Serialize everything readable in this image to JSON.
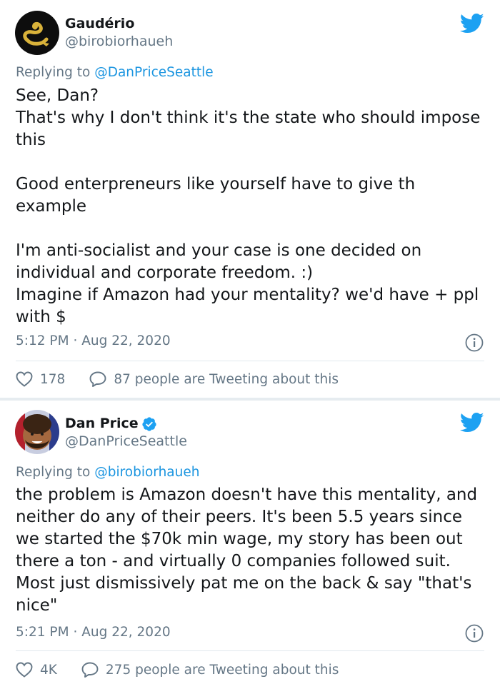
{
  "tweets": [
    {
      "name": "Gaudério",
      "handle": "@birobiorhaueh",
      "verified": false,
      "reply_prefix": "Replying to",
      "reply_to": "@DanPriceSeattle",
      "body": "See, Dan?\nThat's why I don't think it's the state who should impose this\n\nGood enterpreneurs like yourself have to give th example\n\nI'm anti-socialist and your case is one decided on individual and corporate freedom. :)\nImagine if Amazon had your mentality? we'd have + ppl with $",
      "time": "5:12 PM",
      "date": "Aug 22, 2020",
      "likes": "178",
      "tweeting": "87 people are Tweeting about this"
    },
    {
      "name": "Dan Price",
      "handle": "@DanPriceSeattle",
      "verified": true,
      "reply_prefix": "Replying to",
      "reply_to": "@birobiorhaueh",
      "body": "the problem is Amazon doesn't have this mentality, and neither do any of their peers. It's been 5.5 years since we started the $70k min wage, my story has been out there a ton - and virtually 0 companies followed suit. Most just dismissively pat me on the back & say \"that's nice\"",
      "time": "5:21 PM",
      "date": "Aug 22, 2020",
      "likes": "4K",
      "tweeting": "275 people are Tweeting about this"
    }
  ],
  "separator": "·",
  "colors": {
    "twitter_blue": "#1da1f2",
    "mention_blue": "#1b95e0",
    "secondary_text": "#657786",
    "divider": "#e1e8ed"
  },
  "icons": [
    "twitter-bird-icon",
    "info-icon",
    "heart-icon",
    "reply-bubble-icon",
    "verified-badge-icon"
  ]
}
